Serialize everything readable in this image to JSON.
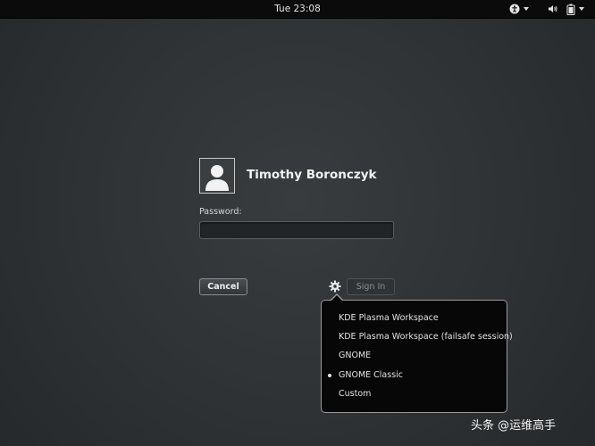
{
  "topbar": {
    "clock": "Tue 23:08",
    "icons": [
      "accessibility-icon",
      "volume-icon",
      "battery-icon"
    ]
  },
  "login": {
    "user_name": "Timothy Boronczyk",
    "password_label": "Password:",
    "password_value": "",
    "cancel_label": "Cancel",
    "signin_label": "Sign In",
    "gear_icon": "settings-gear-icon"
  },
  "session_menu": {
    "items": [
      {
        "label": "KDE Plasma Workspace",
        "selected": false
      },
      {
        "label": "KDE Plasma Workspace (failsafe session)",
        "selected": false
      },
      {
        "label": "GNOME",
        "selected": false
      },
      {
        "label": "GNOME Classic",
        "selected": true
      },
      {
        "label": "Custom",
        "selected": false
      }
    ]
  },
  "watermark": "头条 @运维高手",
  "colors": {
    "background": "#2e3234",
    "topbar": "#0b0b0b",
    "menu_bg": "#070707"
  }
}
